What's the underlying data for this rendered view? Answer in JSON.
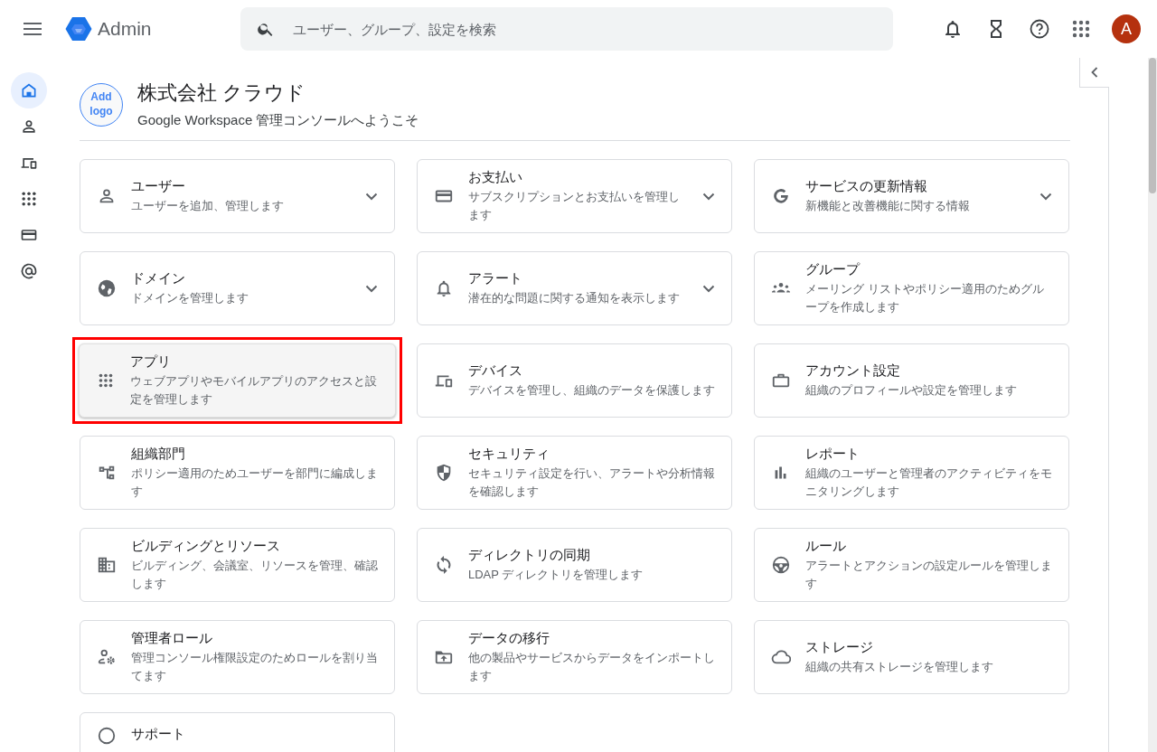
{
  "header": {
    "app_name": "Admin",
    "search": {
      "placeholder": "ユーザー、グループ、設定を検索"
    },
    "avatar": "A"
  },
  "sidebar": {
    "items": [
      {
        "selected": true
      },
      {
        "selected": false
      },
      {
        "selected": false
      },
      {
        "selected": false
      },
      {
        "selected": false
      },
      {
        "selected": false
      }
    ]
  },
  "org": {
    "logo_label": "Add logo",
    "name": "株式会社 クラウド",
    "subtitle": "Google Workspace 管理コンソールへようこそ"
  },
  "cards": [
    {
      "title": "ユーザー",
      "description": "ユーザーを追加、管理します",
      "expandable": true,
      "highlighted": false
    },
    {
      "title": "お支払い",
      "description": "サブスクリプションとお支払いを管理します",
      "expandable": true,
      "highlighted": false
    },
    {
      "title": "サービスの更新情報",
      "description": "新機能と改善機能に関する情報",
      "expandable": true,
      "highlighted": false
    },
    {
      "title": "ドメイン",
      "description": "ドメインを管理します",
      "expandable": true,
      "highlighted": false
    },
    {
      "title": "アラート",
      "description": "潜在的な問題に関する通知を表示します",
      "expandable": true,
      "highlighted": false
    },
    {
      "title": "グループ",
      "description": "メーリング リストやポリシー適用のためグループを作成します",
      "expandable": false,
      "highlighted": false
    },
    {
      "title": "アプリ",
      "description": "ウェブアプリやモバイルアプリのアクセスと設定を管理します",
      "expandable": false,
      "highlighted": true
    },
    {
      "title": "デバイス",
      "description": "デバイスを管理し、組織のデータを保護します",
      "expandable": false,
      "highlighted": false
    },
    {
      "title": "アカウント設定",
      "description": "組織のプロフィールや設定を管理します",
      "expandable": false,
      "highlighted": false
    },
    {
      "title": "組織部門",
      "description": "ポリシー適用のためユーザーを部門に編成します",
      "expandable": false,
      "highlighted": false
    },
    {
      "title": "セキュリティ",
      "description": "セキュリティ設定を行い、アラートや分析情報を確認します",
      "expandable": false,
      "highlighted": false
    },
    {
      "title": "レポート",
      "description": "組織のユーザーと管理者のアクティビティをモニタリングします",
      "expandable": false,
      "highlighted": false
    },
    {
      "title": "ビルディングとリソース",
      "description": "ビルディング、会議室、リソースを管理、確認します",
      "expandable": false,
      "highlighted": false
    },
    {
      "title": "ディレクトリの同期",
      "description": "LDAP ディレクトリを管理します",
      "expandable": false,
      "highlighted": false
    },
    {
      "title": "ルール",
      "description": "アラートとアクションの設定ルールを管理します",
      "expandable": false,
      "highlighted": false
    },
    {
      "title": "管理者ロール",
      "description": "管理コンソール権限設定のためロールを割り当てます",
      "expandable": false,
      "highlighted": false
    },
    {
      "title": "データの移行",
      "description": "他の製品やサービスからデータをインポートします",
      "expandable": false,
      "highlighted": false
    },
    {
      "title": "ストレージ",
      "description": "組織の共有ストレージを管理します",
      "expandable": false,
      "highlighted": false
    },
    {
      "title": "サポート",
      "expandable": false,
      "highlighted": false
    }
  ]
}
